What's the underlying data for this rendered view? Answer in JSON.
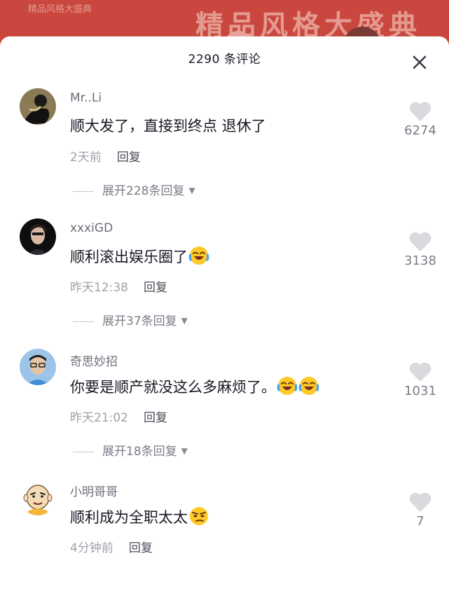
{
  "background": {
    "faint_title": "精品风格大盛典",
    "faint_left": "精品风格大盛典"
  },
  "sheet": {
    "title": "2290 条评论",
    "close_icon": "close-icon"
  },
  "colors": {
    "username": "#6b6e7a",
    "muted": "#9fa1a8",
    "heart": "#d9dadd",
    "header_bg": "#c9473f"
  },
  "comments": [
    {
      "username": "Mr..Li",
      "text": "顺大发了，直接到终点 退休了",
      "emojis": [],
      "time": "2天前",
      "reply": "回复",
      "expand": "展开228条回复",
      "likes": "6274",
      "avatar_icon": "dark-figure-avatar"
    },
    {
      "username": "xxxiGD",
      "text": "顺利滚出娱乐圈了",
      "emojis": [
        "laughing-crying-emoji"
      ],
      "time": "昨天12:38",
      "reply": "回复",
      "expand": "展开37条回复",
      "likes": "3138",
      "avatar_icon": "woman-portrait-avatar"
    },
    {
      "username": "奇思妙招",
      "text": "你要是顺产就没这么多麻烦了。",
      "emojis": [
        "laughing-crying-emoji",
        "laughing-crying-emoji"
      ],
      "time": "昨天21:02",
      "reply": "回复",
      "expand": "展开18条回复",
      "likes": "1031",
      "avatar_icon": "man-glasses-avatar"
    },
    {
      "username": "小明哥哥",
      "text": "顺利成为全职太太",
      "emojis": [
        "smirking-emoji"
      ],
      "time": "4分钟前",
      "reply": "回复",
      "likes": "7",
      "avatar_icon": "cartoon-boy-avatar"
    }
  ]
}
